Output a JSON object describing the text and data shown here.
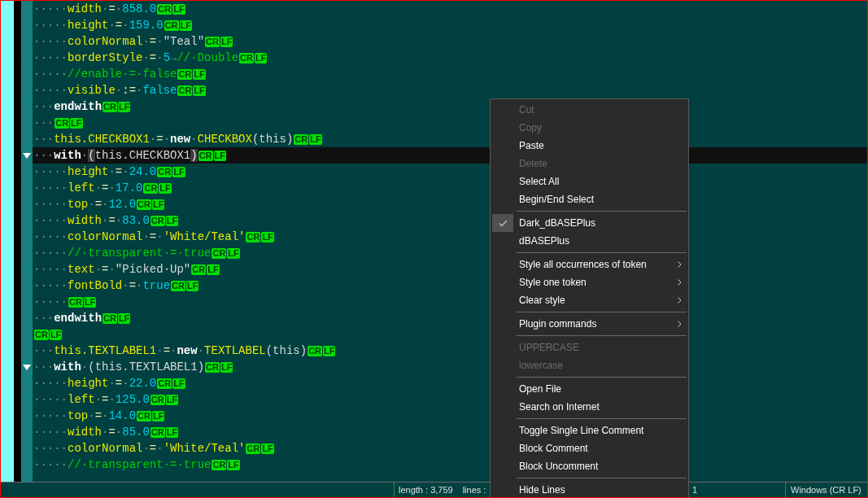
{
  "editor": {
    "lines": [
      {
        "tokens": [
          {
            "kind": "ws",
            "text": "·····"
          },
          {
            "kind": "id",
            "text": "width"
          },
          {
            "kind": "ws",
            "text": "·"
          },
          {
            "kind": "op",
            "text": "="
          },
          {
            "kind": "ws",
            "text": "·"
          },
          {
            "kind": "num",
            "text": "858.0"
          }
        ],
        "eol": [
          "CR",
          "LF"
        ]
      },
      {
        "tokens": [
          {
            "kind": "ws",
            "text": "·····"
          },
          {
            "kind": "id",
            "text": "height"
          },
          {
            "kind": "ws",
            "text": "·"
          },
          {
            "kind": "op",
            "text": "="
          },
          {
            "kind": "ws",
            "text": "·"
          },
          {
            "kind": "num",
            "text": "159.0"
          }
        ],
        "eol": [
          "CR",
          "LF"
        ]
      },
      {
        "tokens": [
          {
            "kind": "ws",
            "text": "·····"
          },
          {
            "kind": "id",
            "text": "colorNormal"
          },
          {
            "kind": "ws",
            "text": "·"
          },
          {
            "kind": "op",
            "text": "="
          },
          {
            "kind": "ws",
            "text": "·"
          },
          {
            "kind": "str",
            "text": "\"Teal\""
          }
        ],
        "eol": [
          "CR",
          "LF"
        ]
      },
      {
        "tokens": [
          {
            "kind": "ws",
            "text": "·····"
          },
          {
            "kind": "id",
            "text": "borderStyle"
          },
          {
            "kind": "ws",
            "text": "·"
          },
          {
            "kind": "op",
            "text": "="
          },
          {
            "kind": "ws",
            "text": "·"
          },
          {
            "kind": "num",
            "text": "5"
          },
          {
            "kind": "ws",
            "text": "→"
          },
          {
            "kind": "com",
            "text": "//·Double"
          }
        ],
        "eol": [
          "CR",
          "LF"
        ]
      },
      {
        "tokens": [
          {
            "kind": "ws",
            "text": "·····"
          },
          {
            "kind": "com",
            "text": "//enable·=·false"
          }
        ],
        "eol": [
          "CR",
          "LF"
        ]
      },
      {
        "tokens": [
          {
            "kind": "ws",
            "text": "·····"
          },
          {
            "kind": "id",
            "text": "visible"
          },
          {
            "kind": "ws",
            "text": "·"
          },
          {
            "kind": "op",
            "text": ":="
          },
          {
            "kind": "ws",
            "text": "·"
          },
          {
            "kind": "num",
            "text": "false"
          }
        ],
        "eol": [
          "CR",
          "LF"
        ]
      },
      {
        "tokens": [
          {
            "kind": "ws",
            "text": "···"
          },
          {
            "kind": "kw",
            "text": "endwith"
          }
        ],
        "eol": [
          "CR",
          "LF"
        ]
      },
      {
        "tokens": [
          {
            "kind": "ws",
            "text": "···"
          }
        ],
        "eol": [
          "CR",
          "LF"
        ]
      },
      {
        "tokens": [
          {
            "kind": "ws",
            "text": "···"
          },
          {
            "kind": "id",
            "text": "this.CHECKBOX1"
          },
          {
            "kind": "ws",
            "text": "·"
          },
          {
            "kind": "op",
            "text": "="
          },
          {
            "kind": "ws",
            "text": "·"
          },
          {
            "kind": "kw",
            "text": "new"
          },
          {
            "kind": "ws",
            "text": "·"
          },
          {
            "kind": "id",
            "text": "CHECKBOX"
          },
          {
            "kind": "plain",
            "text": "(this)"
          }
        ],
        "eol": [
          "CR",
          "LF"
        ]
      },
      {
        "current": true,
        "fold": true,
        "tokens": [
          {
            "kind": "ws",
            "text": "···"
          },
          {
            "kind": "kw",
            "text": "with"
          },
          {
            "kind": "ws",
            "text": "·"
          },
          {
            "kind": "brace",
            "text": "("
          },
          {
            "kind": "plain",
            "text": "this.CHECKBOX1"
          },
          {
            "kind": "brace",
            "text": ")"
          }
        ],
        "eol": [
          "CR",
          "LF"
        ]
      },
      {
        "tokens": [
          {
            "kind": "ws",
            "text": "·····"
          },
          {
            "kind": "id",
            "text": "height"
          },
          {
            "kind": "ws",
            "text": "·"
          },
          {
            "kind": "op",
            "text": "="
          },
          {
            "kind": "ws",
            "text": "·"
          },
          {
            "kind": "num",
            "text": "24.0"
          }
        ],
        "eol": [
          "CR",
          "LF"
        ]
      },
      {
        "tokens": [
          {
            "kind": "ws",
            "text": "·····"
          },
          {
            "kind": "id",
            "text": "left"
          },
          {
            "kind": "ws",
            "text": "·"
          },
          {
            "kind": "op",
            "text": "="
          },
          {
            "kind": "ws",
            "text": "·"
          },
          {
            "kind": "num",
            "text": "17.0"
          }
        ],
        "eol": [
          "CR",
          "LF"
        ]
      },
      {
        "tokens": [
          {
            "kind": "ws",
            "text": "·····"
          },
          {
            "kind": "id",
            "text": "top"
          },
          {
            "kind": "ws",
            "text": "·"
          },
          {
            "kind": "op",
            "text": "="
          },
          {
            "kind": "ws",
            "text": "·"
          },
          {
            "kind": "num",
            "text": "12.0"
          }
        ],
        "eol": [
          "CR",
          "LF"
        ]
      },
      {
        "tokens": [
          {
            "kind": "ws",
            "text": "·····"
          },
          {
            "kind": "id",
            "text": "width"
          },
          {
            "kind": "ws",
            "text": "·"
          },
          {
            "kind": "op",
            "text": "="
          },
          {
            "kind": "ws",
            "text": "·"
          },
          {
            "kind": "num",
            "text": "83.0"
          }
        ],
        "eol": [
          "CR",
          "LF"
        ]
      },
      {
        "tokens": [
          {
            "kind": "ws",
            "text": "·····"
          },
          {
            "kind": "id",
            "text": "colorNormal"
          },
          {
            "kind": "ws",
            "text": "·"
          },
          {
            "kind": "op",
            "text": "="
          },
          {
            "kind": "ws",
            "text": "·"
          },
          {
            "kind": "chr",
            "text": "'White/Teal'"
          }
        ],
        "eol": [
          "CR",
          "LF"
        ]
      },
      {
        "tokens": [
          {
            "kind": "ws",
            "text": "·····"
          },
          {
            "kind": "com",
            "text": "//·transparent·=·true"
          }
        ],
        "eol": [
          "CR",
          "LF"
        ]
      },
      {
        "tokens": [
          {
            "kind": "ws",
            "text": "·····"
          },
          {
            "kind": "id",
            "text": "text"
          },
          {
            "kind": "ws",
            "text": "·"
          },
          {
            "kind": "op",
            "text": "="
          },
          {
            "kind": "ws",
            "text": "·"
          },
          {
            "kind": "str",
            "text": "\"Picked·Up\""
          }
        ],
        "eol": [
          "CR",
          "LF"
        ]
      },
      {
        "tokens": [
          {
            "kind": "ws",
            "text": "·····"
          },
          {
            "kind": "id",
            "text": "fontBold"
          },
          {
            "kind": "ws",
            "text": "·"
          },
          {
            "kind": "op",
            "text": "="
          },
          {
            "kind": "ws",
            "text": "·"
          },
          {
            "kind": "num",
            "text": "true"
          }
        ],
        "eol": [
          "CR",
          "LF"
        ]
      },
      {
        "tokens": [
          {
            "kind": "ws",
            "text": "·····"
          }
        ],
        "eol": [
          "CR",
          "LF"
        ]
      },
      {
        "tokens": [
          {
            "kind": "ws",
            "text": "···"
          },
          {
            "kind": "kw",
            "text": "endwith"
          }
        ],
        "eol": [
          "CR",
          "LF"
        ]
      },
      {
        "eol": [
          "CR",
          "LF"
        ]
      },
      {
        "tokens": [
          {
            "kind": "ws",
            "text": "···"
          },
          {
            "kind": "id",
            "text": "this.TEXTLABEL1"
          },
          {
            "kind": "ws",
            "text": "·"
          },
          {
            "kind": "op",
            "text": "="
          },
          {
            "kind": "ws",
            "text": "·"
          },
          {
            "kind": "kw",
            "text": "new"
          },
          {
            "kind": "ws",
            "text": "·"
          },
          {
            "kind": "id",
            "text": "TEXTLABEL"
          },
          {
            "kind": "plain",
            "text": "(this)"
          }
        ],
        "eol": [
          "CR",
          "LF"
        ]
      },
      {
        "fold": true,
        "tokens": [
          {
            "kind": "ws",
            "text": "···"
          },
          {
            "kind": "kw",
            "text": "with"
          },
          {
            "kind": "ws",
            "text": "·"
          },
          {
            "kind": "plain",
            "text": "(this.TEXTLABEL1)"
          }
        ],
        "eol": [
          "CR",
          "LF"
        ]
      },
      {
        "tokens": [
          {
            "kind": "ws",
            "text": "·····"
          },
          {
            "kind": "id",
            "text": "height"
          },
          {
            "kind": "ws",
            "text": "·"
          },
          {
            "kind": "op",
            "text": "="
          },
          {
            "kind": "ws",
            "text": "·"
          },
          {
            "kind": "num",
            "text": "22.0"
          }
        ],
        "eol": [
          "CR",
          "LF"
        ]
      },
      {
        "tokens": [
          {
            "kind": "ws",
            "text": "·····"
          },
          {
            "kind": "id",
            "text": "left"
          },
          {
            "kind": "ws",
            "text": "·"
          },
          {
            "kind": "op",
            "text": "="
          },
          {
            "kind": "ws",
            "text": "·"
          },
          {
            "kind": "num",
            "text": "125.0"
          }
        ],
        "eol": [
          "CR",
          "LF"
        ]
      },
      {
        "tokens": [
          {
            "kind": "ws",
            "text": "·····"
          },
          {
            "kind": "id",
            "text": "top"
          },
          {
            "kind": "ws",
            "text": "·"
          },
          {
            "kind": "op",
            "text": "="
          },
          {
            "kind": "ws",
            "text": "·"
          },
          {
            "kind": "num",
            "text": "14.0"
          }
        ],
        "eol": [
          "CR",
          "LF"
        ]
      },
      {
        "tokens": [
          {
            "kind": "ws",
            "text": "·····"
          },
          {
            "kind": "id",
            "text": "width"
          },
          {
            "kind": "ws",
            "text": "·"
          },
          {
            "kind": "op",
            "text": "="
          },
          {
            "kind": "ws",
            "text": "·"
          },
          {
            "kind": "num",
            "text": "85.0"
          }
        ],
        "eol": [
          "CR",
          "LF"
        ]
      },
      {
        "tokens": [
          {
            "kind": "ws",
            "text": "·····"
          },
          {
            "kind": "id",
            "text": "colorNormal"
          },
          {
            "kind": "ws",
            "text": "·"
          },
          {
            "kind": "op",
            "text": "="
          },
          {
            "kind": "ws",
            "text": "·"
          },
          {
            "kind": "chr",
            "text": "'White/Teal'"
          }
        ],
        "eol": [
          "CR",
          "LF"
        ]
      },
      {
        "tokens": [
          {
            "kind": "ws",
            "text": "·····"
          },
          {
            "kind": "com",
            "text": "//·transparent·=·true"
          }
        ],
        "eol": [
          "CR",
          "LF"
        ]
      }
    ]
  },
  "context_menu": {
    "groups": [
      [
        {
          "label": "Cut",
          "disabled": true
        },
        {
          "label": "Copy",
          "disabled": true
        },
        {
          "label": "Paste",
          "disabled": false
        },
        {
          "label": "Delete",
          "disabled": true
        },
        {
          "label": "Select All",
          "disabled": false
        },
        {
          "label": "Begin/End Select",
          "disabled": false
        }
      ],
      [
        {
          "label": "Dark_dBASEPlus",
          "checked": true
        },
        {
          "label": "dBASEPlus",
          "checked": false
        }
      ],
      [
        {
          "label": "Style all occurrences of token",
          "submenu": true
        },
        {
          "label": "Style one token",
          "submenu": true
        },
        {
          "label": "Clear style",
          "submenu": true
        }
      ],
      [
        {
          "label": "Plugin commands",
          "submenu": true
        }
      ],
      [
        {
          "label": "UPPERCASE",
          "disabled": true
        },
        {
          "label": "lowercase",
          "disabled": true
        }
      ],
      [
        {
          "label": "Open File"
        },
        {
          "label": "Search on Internet"
        }
      ],
      [
        {
          "label": "Toggle Single Line Comment"
        },
        {
          "label": "Block Comment"
        },
        {
          "label": "Block Uncomment"
        }
      ],
      [
        {
          "label": "Hide Lines"
        }
      ]
    ]
  },
  "status_bar": {
    "length": "length : 3,759",
    "lines": "lines :",
    "position_tail": "1",
    "eol_format": "Windows (CR LF)"
  }
}
